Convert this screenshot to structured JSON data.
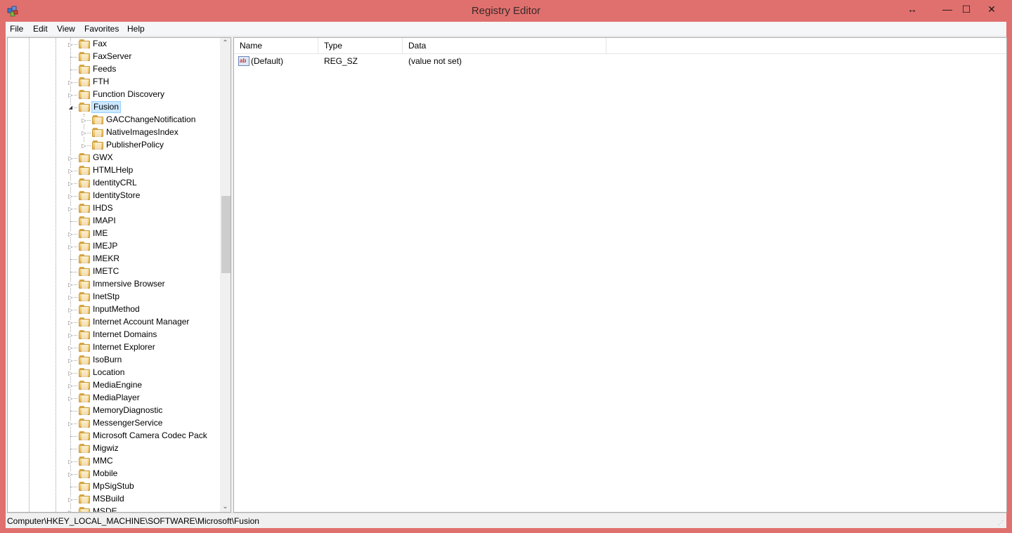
{
  "window": {
    "title": "Registry Editor"
  },
  "titlebar": {
    "restore_glyph": "↔",
    "minimize_glyph": "—",
    "maximize_glyph": "☐",
    "close_glyph": "✕"
  },
  "menu": [
    {
      "label": "File"
    },
    {
      "label": "Edit"
    },
    {
      "label": "View"
    },
    {
      "label": "Favorites"
    },
    {
      "label": "Help"
    }
  ],
  "tree": {
    "selected": "Fusion",
    "items": [
      {
        "label": "Fax",
        "level": 1,
        "expander": "collapsed"
      },
      {
        "label": "FaxServer",
        "level": 1,
        "expander": "none"
      },
      {
        "label": "Feeds",
        "level": 1,
        "expander": "none"
      },
      {
        "label": "FTH",
        "level": 1,
        "expander": "collapsed"
      },
      {
        "label": "Function Discovery",
        "level": 1,
        "expander": "collapsed"
      },
      {
        "label": "Fusion",
        "level": 1,
        "expander": "expanded"
      },
      {
        "label": "GACChangeNotification",
        "level": 2,
        "expander": "collapsed"
      },
      {
        "label": "NativeImagesIndex",
        "level": 2,
        "expander": "collapsed"
      },
      {
        "label": "PublisherPolicy",
        "level": 2,
        "expander": "collapsed"
      },
      {
        "label": "GWX",
        "level": 1,
        "expander": "collapsed"
      },
      {
        "label": "HTMLHelp",
        "level": 1,
        "expander": "collapsed"
      },
      {
        "label": "IdentityCRL",
        "level": 1,
        "expander": "collapsed"
      },
      {
        "label": "IdentityStore",
        "level": 1,
        "expander": "collapsed"
      },
      {
        "label": "IHDS",
        "level": 1,
        "expander": "collapsed"
      },
      {
        "label": "IMAPI",
        "level": 1,
        "expander": "none"
      },
      {
        "label": "IME",
        "level": 1,
        "expander": "collapsed"
      },
      {
        "label": "IMEJP",
        "level": 1,
        "expander": "collapsed"
      },
      {
        "label": "IMEKR",
        "level": 1,
        "expander": "none"
      },
      {
        "label": "IMETC",
        "level": 1,
        "expander": "none"
      },
      {
        "label": "Immersive Browser",
        "level": 1,
        "expander": "collapsed"
      },
      {
        "label": "InetStp",
        "level": 1,
        "expander": "collapsed"
      },
      {
        "label": "InputMethod",
        "level": 1,
        "expander": "collapsed"
      },
      {
        "label": "Internet Account Manager",
        "level": 1,
        "expander": "collapsed"
      },
      {
        "label": "Internet Domains",
        "level": 1,
        "expander": "collapsed"
      },
      {
        "label": "Internet Explorer",
        "level": 1,
        "expander": "collapsed"
      },
      {
        "label": "IsoBurn",
        "level": 1,
        "expander": "collapsed"
      },
      {
        "label": "Location",
        "level": 1,
        "expander": "collapsed"
      },
      {
        "label": "MediaEngine",
        "level": 1,
        "expander": "collapsed"
      },
      {
        "label": "MediaPlayer",
        "level": 1,
        "expander": "collapsed"
      },
      {
        "label": "MemoryDiagnostic",
        "level": 1,
        "expander": "none"
      },
      {
        "label": "MessengerService",
        "level": 1,
        "expander": "collapsed"
      },
      {
        "label": "Microsoft Camera Codec Pack",
        "level": 1,
        "expander": "none"
      },
      {
        "label": "Migwiz",
        "level": 1,
        "expander": "none"
      },
      {
        "label": "MMC",
        "level": 1,
        "expander": "collapsed"
      },
      {
        "label": "Mobile",
        "level": 1,
        "expander": "collapsed"
      },
      {
        "label": "MpSigStub",
        "level": 1,
        "expander": "none"
      },
      {
        "label": "MSBuild",
        "level": 1,
        "expander": "collapsed"
      },
      {
        "label": "MSDE",
        "level": 1,
        "expander": "collapsed"
      }
    ]
  },
  "list": {
    "columns": [
      {
        "label": "Name"
      },
      {
        "label": "Type"
      },
      {
        "label": "Data"
      }
    ],
    "rows": [
      {
        "icon": "string-value-icon",
        "icon_text": "ab",
        "name": "(Default)",
        "type": "REG_SZ",
        "data": "(value not set)"
      }
    ]
  },
  "statusbar": {
    "path": "Computer\\HKEY_LOCAL_MACHINE\\SOFTWARE\\Microsoft\\Fusion"
  },
  "icons": {
    "expander_collapsed": "▷",
    "expander_expanded": "◢",
    "scroll_up": "⌃",
    "scroll_down": "⌄",
    "grip": "⋰"
  },
  "colors": {
    "titlebar": "#e0706e",
    "selection": "#cce8ff"
  }
}
